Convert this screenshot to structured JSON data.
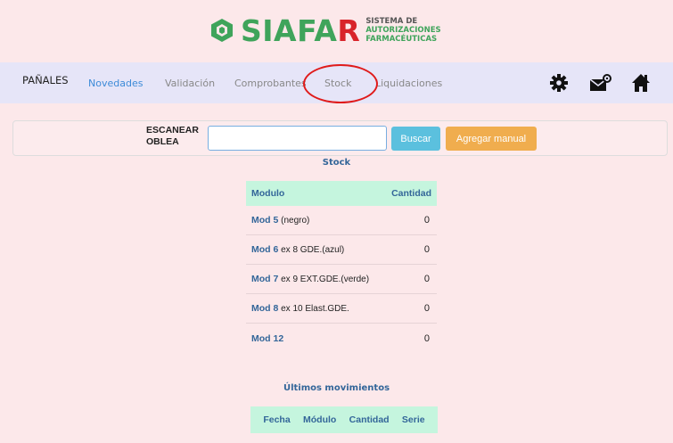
{
  "logo": {
    "word_a": "SIAFA",
    "word_b": "R",
    "sub1": "SISTEMA DE",
    "sub2": "AUTORIZACIONES",
    "sub3": "FARMACÉUTICAS"
  },
  "nav": {
    "brand": "PAÑALES",
    "links": [
      "Novedades",
      "Validación",
      "Comprobantes",
      "Stock",
      "Liquidaciones"
    ],
    "active": "Novedades",
    "icons": [
      "gear-icon",
      "mail-gear-icon",
      "home-icon"
    ]
  },
  "scan": {
    "label_line1": "ESCANEAR",
    "label_line2": "OBLEA",
    "input_value": "",
    "search_label": "Buscar",
    "manual_label": "Agregar manual"
  },
  "stock": {
    "title": "Stock",
    "col_module": "Modulo",
    "col_qty": "Cantidad",
    "rows": [
      {
        "name": "Mod 5",
        "detail": " (negro)",
        "qty": "0"
      },
      {
        "name": "Mod 6",
        "detail": " ex 8 GDE.(azul)",
        "qty": "0"
      },
      {
        "name": "Mod 7",
        "detail": " ex 9 EXT.GDE.(verde)",
        "qty": "0"
      },
      {
        "name": "Mod 8",
        "detail": " ex 10 Elast.GDE.",
        "qty": "0"
      },
      {
        "name": "Mod 12",
        "detail": "",
        "qty": "0"
      }
    ]
  },
  "movements": {
    "title": "Últimos movimientos",
    "columns": [
      "Fecha",
      "Módulo",
      "Cantidad",
      "Serie"
    ]
  },
  "colors": {
    "background": "#fce8ea",
    "navbar": "#e6e5f8",
    "accent_green": "#3fa45b",
    "accent_red": "#d8232a",
    "table_header": "#c5f5de",
    "link_active": "#3d8bd8",
    "btn_search": "#5bc0de",
    "btn_manual": "#f0ad4e"
  }
}
